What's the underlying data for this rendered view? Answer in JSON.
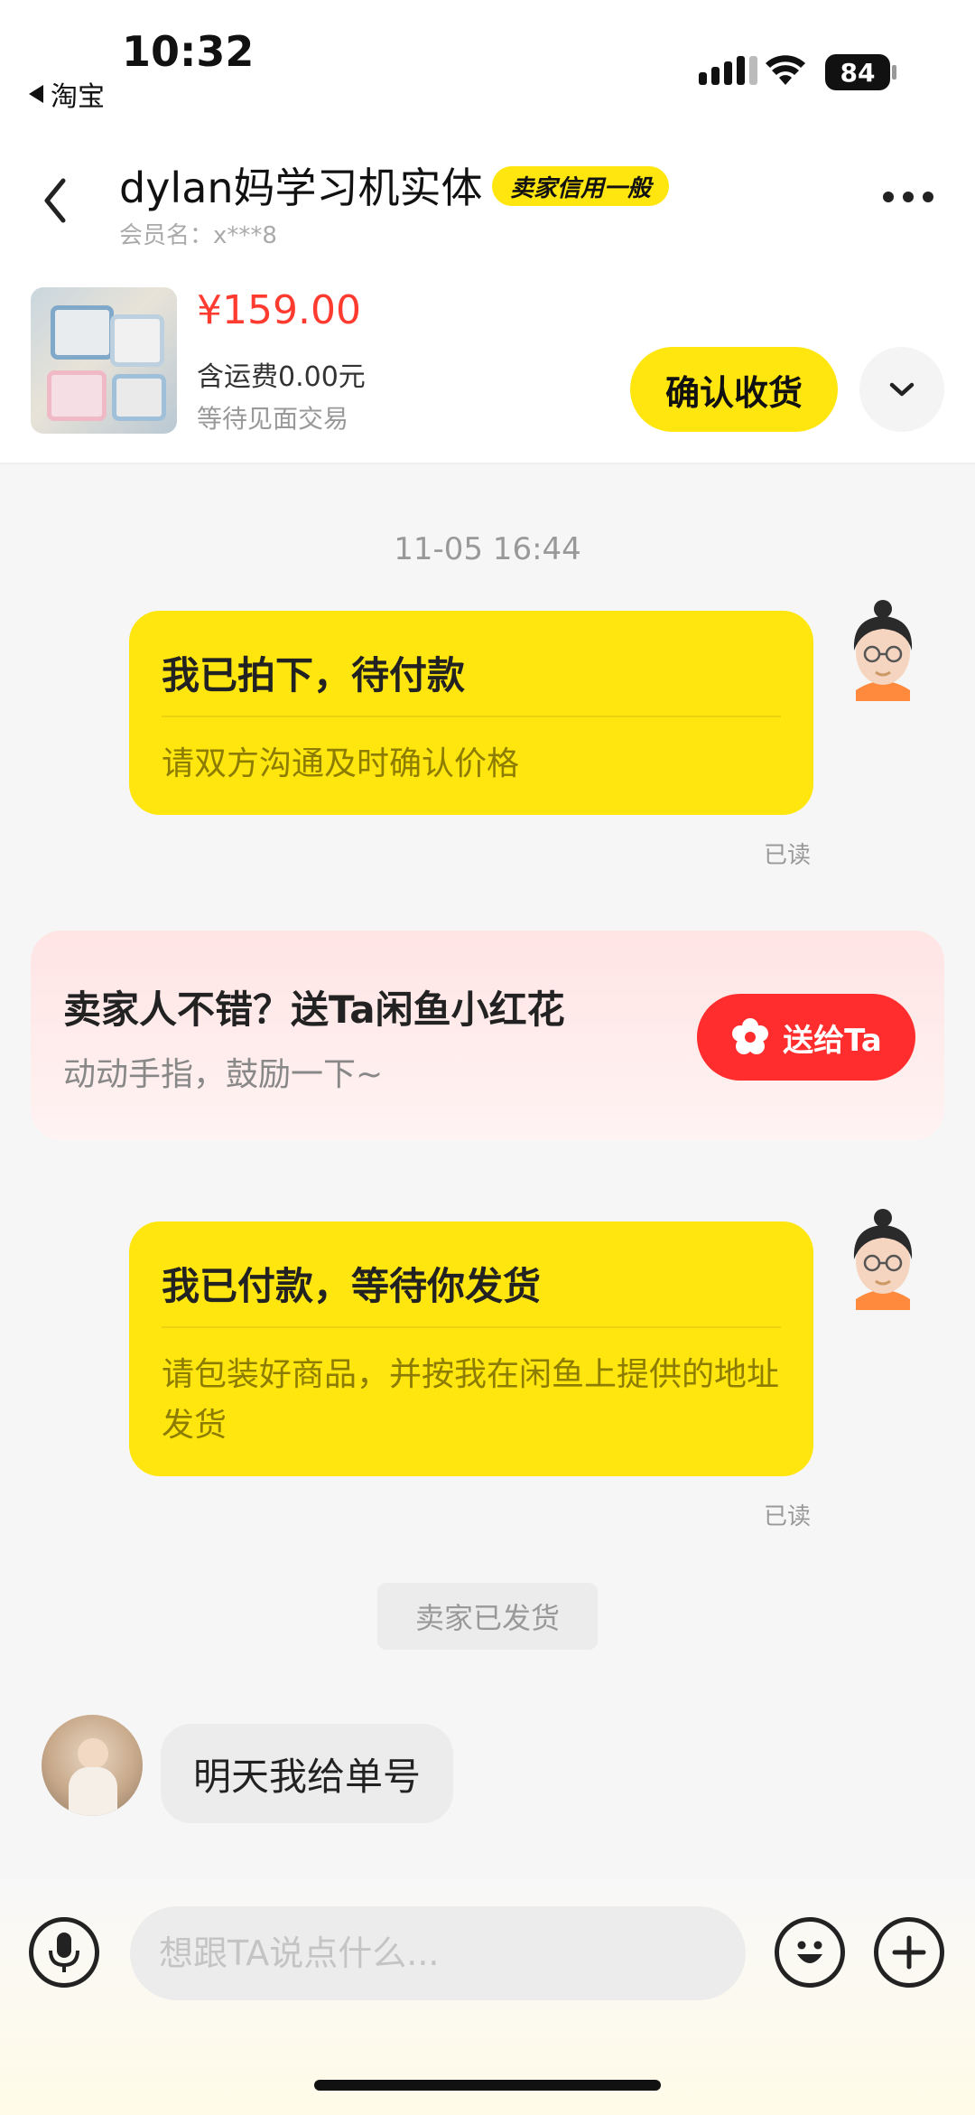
{
  "status_bar": {
    "time": "10:32",
    "back_app": "淘宝",
    "battery": "84"
  },
  "header": {
    "title": "dylan妈学习机实体",
    "credit_badge": "卖家信用一般",
    "member_name": "会员名：x***8"
  },
  "product": {
    "price": "¥159.00",
    "shipping": "含运费0.00元",
    "status": "等待见面交易",
    "confirm_label": "确认收货"
  },
  "chat": {
    "timestamp": "11-05 16:44",
    "card1": {
      "title": "我已拍下，待付款",
      "body": "请双方沟通及时确认价格",
      "read": "已读"
    },
    "flower": {
      "title": "卖家人不错？送Ta闲鱼小红花",
      "subtitle": "动动手指，鼓励一下~",
      "button": "送给Ta"
    },
    "card2": {
      "title": "我已付款，等待你发货",
      "body": "请包装好商品，并按我在闲鱼上提供的地址发货",
      "read": "已读"
    },
    "system_tag": "卖家已发货",
    "seller_message": "明天我给单号"
  },
  "input": {
    "placeholder": "想跟TA说点什么..."
  },
  "colors": {
    "accent_yellow": "#ffe60f",
    "price_red": "#ff3b30",
    "send_red": "#ff2d2d"
  },
  "icons": {
    "voice": "microphone-icon",
    "emoji": "smiley-icon",
    "plus": "plus-icon",
    "back": "chevron-left-icon",
    "more": "more-dots-icon",
    "expand": "chevron-down-icon",
    "flower": "flower-icon"
  }
}
